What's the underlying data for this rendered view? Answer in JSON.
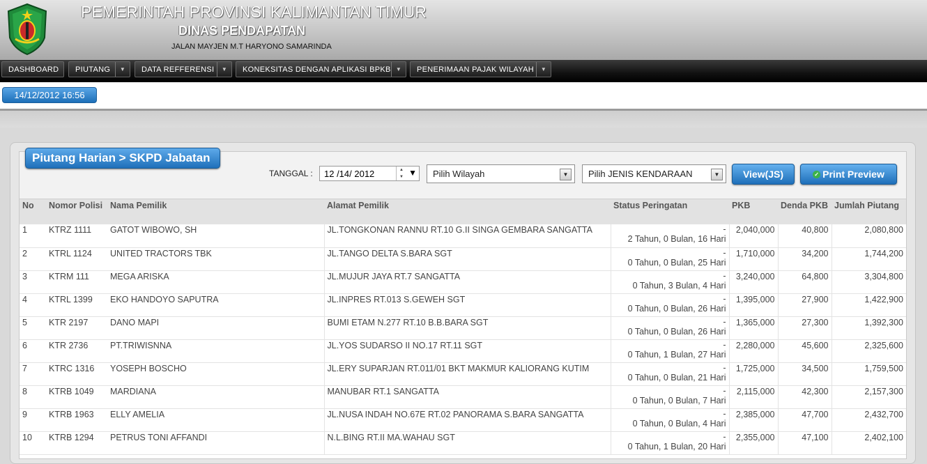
{
  "header": {
    "title1": "PEMERINTAH PROVINSI KALIMANTAN TIMUR",
    "title2": "DINAS PENDAPATAN",
    "address": "JALAN MAYJEN M.T HARYONO SAMARINDA"
  },
  "nav": [
    {
      "label": "DASHBOARD"
    },
    {
      "label": "PIUTANG"
    },
    {
      "label": "DATA REFFERENSI"
    },
    {
      "label": "KONEKSITAS DENGAN APLIKASI BPKB"
    },
    {
      "label": "PENERIMAAN PAJAK WILAYAH"
    }
  ],
  "datetime": "14/12/2012  16:56",
  "panel": {
    "title": "Piutang Harian > SKPD Jabatan",
    "date_label": "TANGGAL :",
    "date_value": "12 /14/  2012",
    "wilayah": "Pilih Wilayah",
    "jenis": "Pilih JENIS KENDARAAN",
    "view_btn": "View(JS)",
    "print_btn": "Print Preview"
  },
  "table": {
    "headers": [
      "No",
      "Nomor Polisi",
      "Nama Pemilik",
      "Alamat Pemilik",
      "Status Peringatan",
      "PKB",
      "Denda PKB",
      "Jumlah Piutang"
    ],
    "rows": [
      [
        "1",
        "KTRZ 1111",
        "GATOT WIBOWO, SH",
        "JL.TONGKONAN RANNU RT.10 G.II SINGA GEMBARA SANGATTA",
        "2 Tahun, 0 Bulan, 16 Hari",
        "2,040,000",
        "40,800",
        "2,080,800"
      ],
      [
        "2",
        "KTRL 1124",
        "UNITED TRACTORS TBK",
        "JL.TANGO DELTA S.BARA SGT",
        "0 Tahun, 0 Bulan, 25 Hari",
        "1,710,000",
        "34,200",
        "1,744,200"
      ],
      [
        "3",
        "KTRM 111",
        "MEGA ARISKA",
        "JL.MUJUR JAYA RT.7 SANGATTA",
        "0 Tahun, 3 Bulan, 4 Hari",
        "3,240,000",
        "64,800",
        "3,304,800"
      ],
      [
        "4",
        "KTRL 1399",
        "EKO HANDOYO SAPUTRA",
        "JL.INPRES RT.013 S.GEWEH SGT",
        "0 Tahun, 0 Bulan, 26 Hari",
        "1,395,000",
        "27,900",
        "1,422,900"
      ],
      [
        "5",
        "KTR 2197",
        "DANO MAPI",
        "BUMI ETAM N.277 RT.10 B.B.BARA SGT",
        "0 Tahun, 0 Bulan, 26 Hari",
        "1,365,000",
        "27,300",
        "1,392,300"
      ],
      [
        "6",
        "KTR 2736",
        "PT.TRIWISNNA",
        "JL.YOS SUDARSO II NO.17 RT.11 SGT",
        "0 Tahun, 1 Bulan, 27 Hari",
        "2,280,000",
        "45,600",
        "2,325,600"
      ],
      [
        "7",
        "KTRC 1316",
        "YOSEPH BOSCHO",
        "JL.ERY SUPARJAN RT.011/01 BKT MAKMUR KALIORANG KUTIM",
        "0 Tahun, 0 Bulan, 21 Hari",
        "1,725,000",
        "34,500",
        "1,759,500"
      ],
      [
        "8",
        "KTRB 1049",
        "MARDIANA",
        "MANUBAR RT.1 SANGATTA",
        "0 Tahun, 0 Bulan, 7 Hari",
        "2,115,000",
        "42,300",
        "2,157,300"
      ],
      [
        "9",
        "KTRB 1963",
        "ELLY AMELIA",
        "JL.NUSA INDAH NO.67E RT.02 PANORAMA S.BARA SANGATTA",
        "0 Tahun, 0 Bulan, 4 Hari",
        "2,385,000",
        "47,700",
        "2,432,700"
      ],
      [
        "10",
        "KTRB 1294",
        "PETRUS TONI AFFANDI",
        "N.L.BING RT.II MA.WAHAU SGT",
        "0 Tahun, 1 Bulan, 20 Hari",
        "2,355,000",
        "47,100",
        "2,402,100"
      ]
    ],
    "status_prefix": "-"
  },
  "colors": {
    "accent": "#1f70ba",
    "nav_bg": "#111111",
    "header_line": "#c8713a"
  }
}
